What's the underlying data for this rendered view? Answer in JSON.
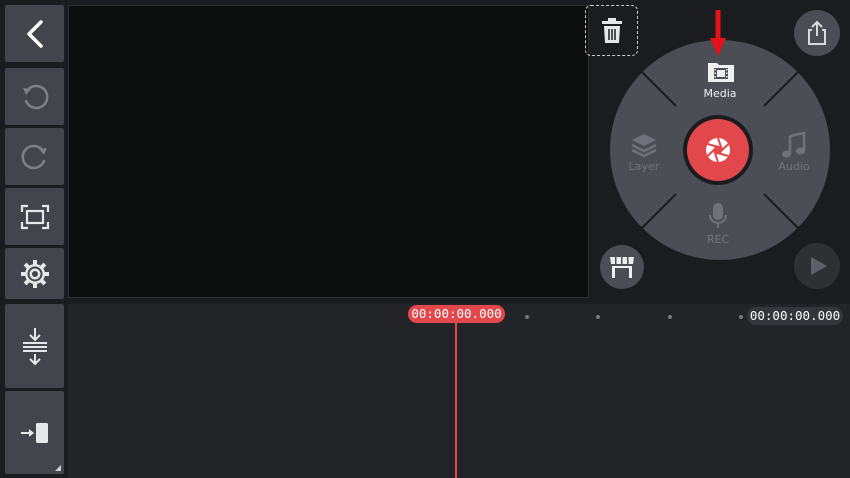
{
  "editor": {
    "playhead_timecode": "00:00:00.000",
    "total_timecode": "00:00:00.000"
  },
  "left_toolbar": {
    "items": [
      {
        "name": "back-button",
        "icon": "chevron-left-icon"
      },
      {
        "name": "undo-button",
        "icon": "undo-icon"
      },
      {
        "name": "redo-button",
        "icon": "redo-icon"
      },
      {
        "name": "fit-screen-button",
        "icon": "crop-frame-icon"
      },
      {
        "name": "settings-button",
        "icon": "gear-icon"
      },
      {
        "name": "expand-timeline-button",
        "icon": "expand-vertical-icon"
      },
      {
        "name": "jump-to-end-button",
        "icon": "arrow-to-clip-icon"
      }
    ]
  },
  "media_wheel": {
    "center_icon": "camera-aperture-icon",
    "accent_color": "#e2474b",
    "items": {
      "media": {
        "label": "Media",
        "icon": "film-folder-icon"
      },
      "layer": {
        "label": "Layer",
        "icon": "layers-icon"
      },
      "audio": {
        "label": "Audio",
        "icon": "music-note-icon"
      },
      "rec": {
        "label": "REC",
        "icon": "microphone-icon"
      }
    }
  },
  "top_right": {
    "share_icon": "share-icon",
    "store_icon": "store-icon",
    "play_icon": "play-icon",
    "delete_icon": "trash-icon"
  },
  "annotation": {
    "arrow_color": "#e6121a"
  }
}
